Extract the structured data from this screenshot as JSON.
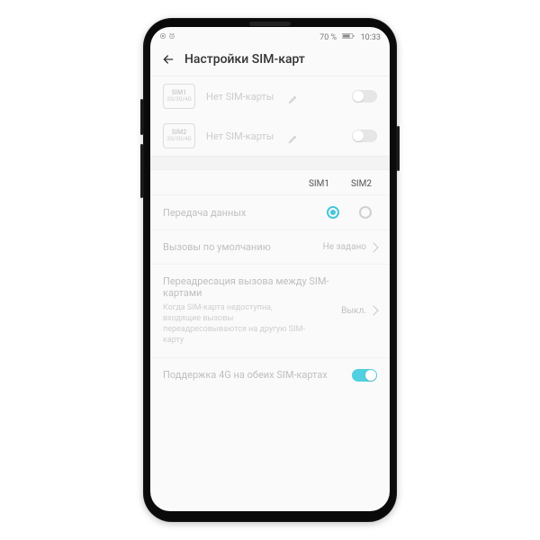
{
  "status": {
    "battery": "70 %",
    "time": "10:33"
  },
  "title": "Настройки SIM-карт",
  "sim_slots": [
    {
      "name": "SIM1",
      "bands": "2G/3G/4G",
      "status": "Нет SIM-карты"
    },
    {
      "name": "SIM2",
      "bands": "2G/3G/4G",
      "status": "Нет SIM-карты"
    }
  ],
  "col_headers": {
    "sim1": "SIM1",
    "sim2": "SIM2"
  },
  "rows": {
    "data": {
      "label": "Передача данных"
    },
    "calls": {
      "label": "Вызовы по умолчанию",
      "value": "Не задано"
    },
    "forward": {
      "label": "Переадресация вызова между SIM-картами",
      "sub": "Когда SIM-карта недоступна, входящие вызовы переадресовываются на другую SIM-карту",
      "value": "Выкл."
    },
    "dual4g": {
      "label": "Поддержка 4G на обеих SIM-картах"
    }
  }
}
